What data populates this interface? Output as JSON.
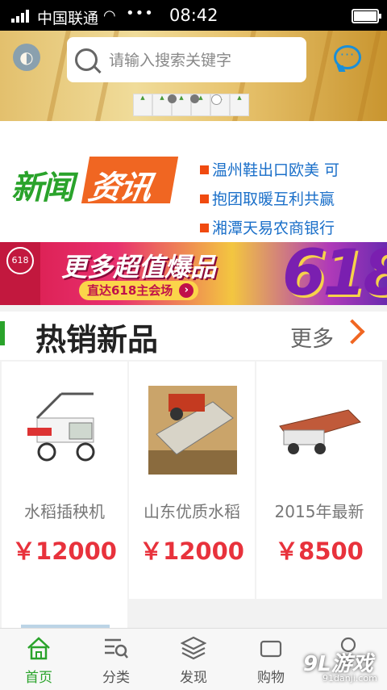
{
  "status_bar": {
    "carrier": "中国联通",
    "time": "08:42"
  },
  "header": {
    "search_placeholder": "请输入搜索关键字"
  },
  "news": {
    "headlines": [
      "温州鞋出口欧美 可",
      "抱团取暖互利共赢",
      "湘潭天易农商银行"
    ]
  },
  "promo_banner": {
    "text": "更多超值爆品",
    "button": "直达618主会场",
    "big": "618"
  },
  "hot_section": {
    "title": "热销新品",
    "more": "更多"
  },
  "products": [
    {
      "name": "水稻插秧机",
      "price": "￥12000"
    },
    {
      "name": "山东优质水稻",
      "price": "￥12000"
    },
    {
      "name": "2015年最新",
      "price": "￥8500"
    }
  ],
  "tabs": [
    {
      "label": "首页",
      "icon": "home-icon",
      "active": true
    },
    {
      "label": "分类",
      "icon": "category-icon"
    },
    {
      "label": "发现",
      "icon": "discover-icon"
    },
    {
      "label": "购物",
      "icon": "cart-icon"
    },
    {
      "label": "",
      "icon": "user-icon"
    }
  ],
  "watermark": {
    "title": "9L游戏",
    "url": "91danji.com"
  },
  "colors": {
    "brand_green": "#2aa32b",
    "accent_orange": "#f06622",
    "price_red": "#e8323c",
    "link_blue": "#1a6fc9"
  }
}
